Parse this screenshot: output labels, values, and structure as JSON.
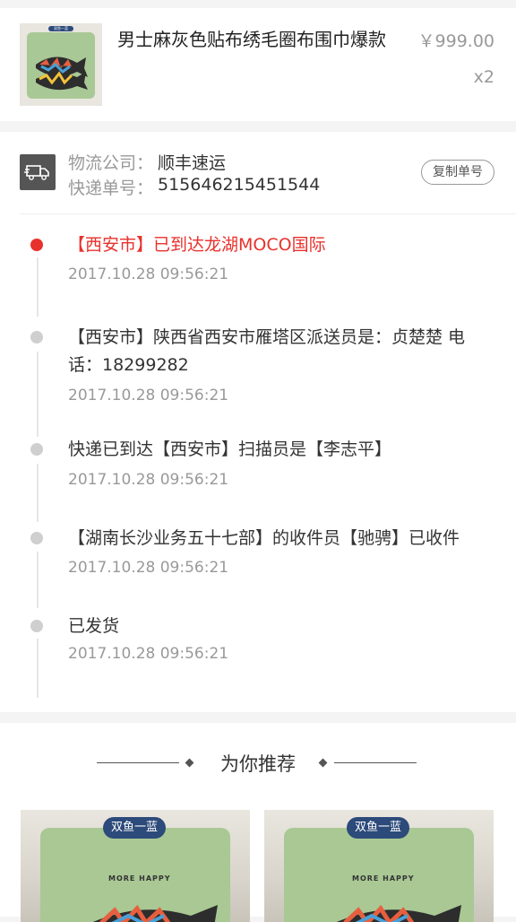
{
  "product": {
    "title": "男士麻灰色贴布绣毛圈布围巾爆款",
    "price": "￥999.00",
    "quantity": "x2",
    "image_badge": "双鱼一蓝"
  },
  "logistics": {
    "company_label": "物流公司：",
    "company_value": "顺丰速运",
    "tracking_label": "快递单号：",
    "tracking_value": "515646215451544",
    "copy_button": "复制单号"
  },
  "events": [
    {
      "text": "【西安市】已到达龙湖MOCO国际",
      "time": "2017.10.28  09:56:21",
      "active": true
    },
    {
      "text": "【西安市】陕西省西安市雁塔区派送员是：贞楚楚 电话：18299282",
      "time": "2017.10.28  09:56:21",
      "active": false
    },
    {
      "text": "快递已到达【西安市】扫描员是【李志平】",
      "time": "2017.10.28  09:56:21",
      "active": false
    },
    {
      "text": "【湖南长沙业务五十七部】的收件员【驰骋】已收件",
      "time": "2017.10.28  09:56:21",
      "active": false
    },
    {
      "text": "已发货",
      "time": "2017.10.28  09:56:21",
      "active": false
    }
  ],
  "recommend": {
    "title": "为你推荐",
    "cards": [
      {
        "tag": "双鱼一蓝",
        "pillow_text": "MORE HAPPY"
      },
      {
        "tag": "双鱼一蓝",
        "pillow_text": "MORE HAPPY"
      }
    ]
  },
  "colors": {
    "accent": "#e8312c",
    "muted": "#999999",
    "tag_bg": "#2c4a7a"
  },
  "icons": {
    "logistics": "truck-icon",
    "timeline_active": "red-dot-icon",
    "timeline": "gray-dot-icon"
  }
}
